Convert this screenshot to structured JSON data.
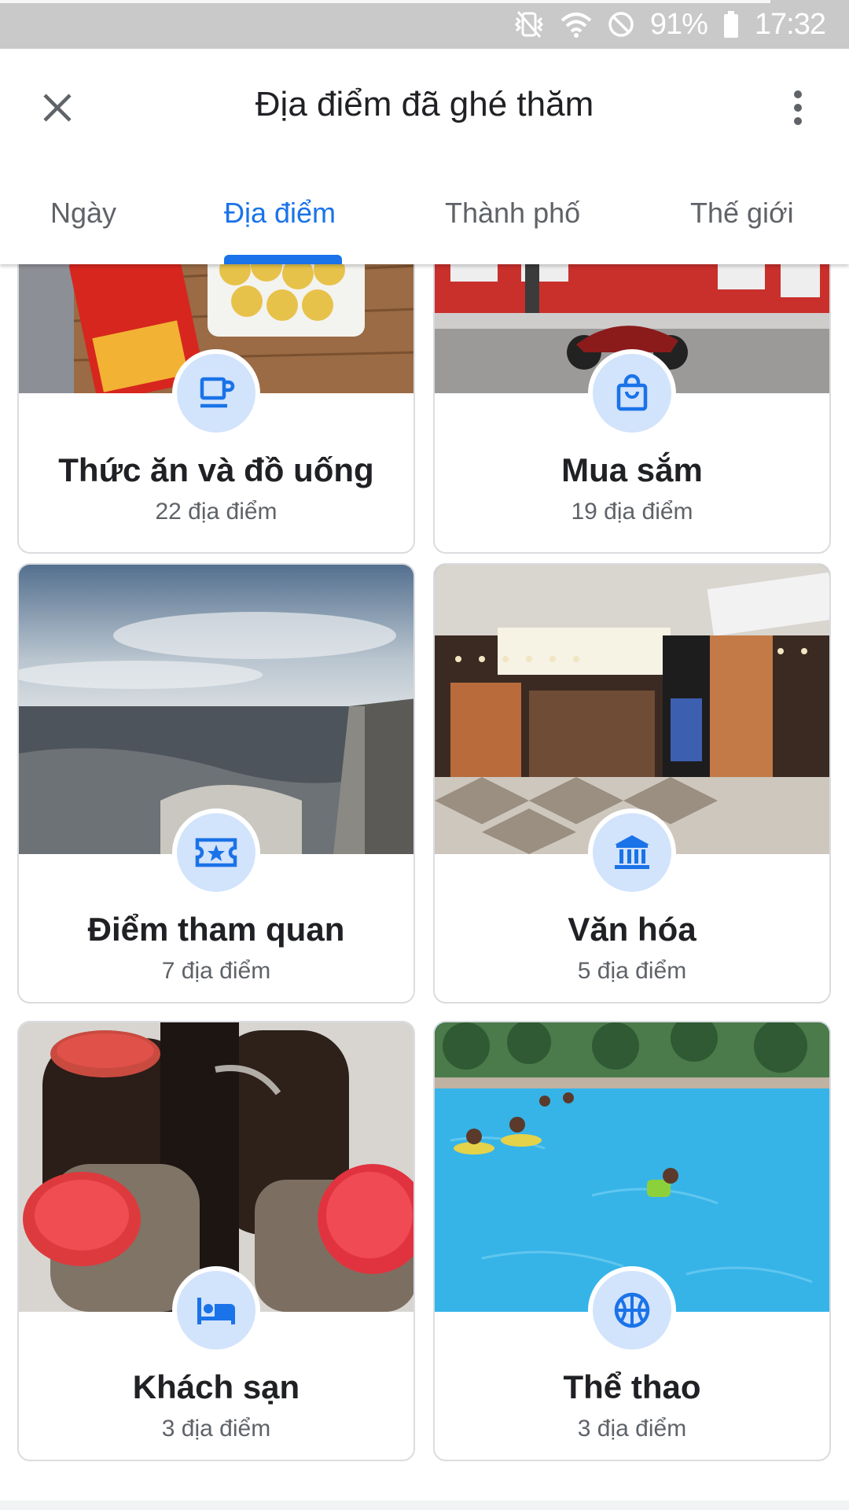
{
  "status_bar": {
    "battery": "91%",
    "time": "17:32",
    "icons": [
      "vibrate-icon",
      "wifi-icon",
      "do-not-disturb-icon",
      "battery-icon"
    ]
  },
  "header": {
    "title": "Địa điểm đã ghé thăm",
    "close_icon": "close-icon",
    "menu_icon": "more-vert-icon"
  },
  "tabs": [
    {
      "label": "Ngày",
      "active": false
    },
    {
      "label": "Địa điểm",
      "active": true
    },
    {
      "label": "Thành phố",
      "active": false
    },
    {
      "label": "Thế giới",
      "active": false
    }
  ],
  "categories": [
    {
      "title": "Thức ăn và đồ uống",
      "count": "22 địa điểm",
      "icon": "coffee-cup-icon"
    },
    {
      "title": "Mua sắm",
      "count": "19 địa điểm",
      "icon": "shopping-bag-icon"
    },
    {
      "title": "Điểm tham quan",
      "count": "7 địa điểm",
      "icon": "ticket-star-icon"
    },
    {
      "title": "Văn hóa",
      "count": "5 địa điểm",
      "icon": "museum-icon"
    },
    {
      "title": "Khách sạn",
      "count": "3 địa điểm",
      "icon": "hotel-bed-icon"
    },
    {
      "title": "Thể thao",
      "count": "3 địa điểm",
      "icon": "sports-ball-icon"
    }
  ],
  "colors": {
    "accent": "#1a73e8",
    "icon_bg": "#d2e3fc",
    "text_primary": "#202124",
    "text_secondary": "#5f6368",
    "status_bar": "#c9c9c9"
  }
}
